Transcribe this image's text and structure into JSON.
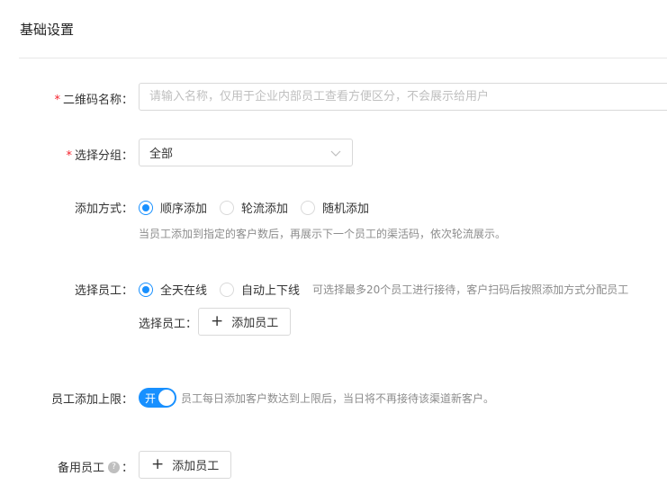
{
  "section_title": "基础设置",
  "qrcode_name": {
    "label": "二维码名称：",
    "placeholder": "请输入名称，仅用于企业内部员工查看方便区分，不会展示给用户",
    "value": ""
  },
  "group": {
    "label": "选择分组：",
    "value": "全部"
  },
  "add_mode": {
    "label": "添加方式：",
    "options": [
      "顺序添加",
      "轮流添加",
      "随机添加"
    ],
    "selected": "顺序添加",
    "hint": "当员工添加到指定的客户数后，再展示下一个员工的渠活码，依次轮流展示。"
  },
  "staff": {
    "label": "选择员工：",
    "options": [
      "全天在线",
      "自动上下线"
    ],
    "selected": "全天在线",
    "hint": "可选择最多20个员工进行接待，客户扫码后按照添加方式分配员工",
    "sub_label": "选择员工：",
    "add_button": "添加员工"
  },
  "limit": {
    "label": "员工添加上限：",
    "switch_text": "开",
    "switch_on": true,
    "hint": "员工每日添加客户数达到上限后，当日将不再接待该渠道新客户。"
  },
  "backup": {
    "label": "备用员工",
    "colon": "：",
    "help_symbol": "?",
    "add_button": "添加员工"
  },
  "required_mark": "*",
  "colors": {
    "primary": "#1890ff",
    "required": "#f5222d",
    "hint": "#8c8c8c"
  }
}
